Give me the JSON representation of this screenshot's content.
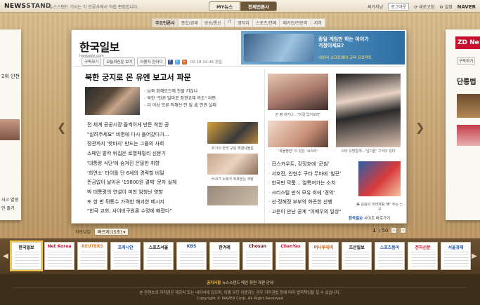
{
  "topbar": {
    "logo_a": "NEWS",
    "logo_b": "STAND",
    "tagline": "뉴스스탠드 기사는 각 언론사에서 직접 편집합니다.",
    "tabs": [
      "MY뉴스",
      "전체언론사"
    ],
    "right": [
      "써가지닝",
      "로그아웃",
      "새로고침",
      "설정",
      "NAVER"
    ]
  },
  "paper_tabs": [
    "주요언론사",
    "종합/경제",
    "방송/통신",
    "IT",
    "영자지",
    "스포츠/연예",
    "매거진/전문지",
    "지역"
  ],
  "masthead": {
    "title": "한국일보",
    "url": "hankooki.com"
  },
  "ad": {
    "line1": "종일 계임만 하는 아이가",
    "line2": "걱정이세요?",
    "line3": "네이버 소프트웨어 교육 프로젝트"
  },
  "toolbar": {
    "subscribe": "구독하기",
    "today_paper": "오늘의신문 보기",
    "help": "이용자 한마디",
    "date": "02-18 22:46 편집"
  },
  "headline": "북한 궁지로 몬 유엔 보고서 파문",
  "sub_items": [
    "남북 화해모드에 찬물 끼얹나",
    "북한 \"인권 빌미로 정권교체 의도\" 비판",
    "더 이상 모른 척해선 안 될 北 인권 실태"
  ],
  "left_list": [
    "전 세계 공공시장 들썩이게 만든 착한 공",
    "\"살려주세요\" 비명에 다시 들어갔다가…",
    "장관까지 '핫바지' 만드는 그들의 사회",
    "스페인 발칵 뒤집은 로열패밀리 신문기",
    "'대통령 식단'에 숨겨진 은밀한 취향",
    "'희연소' 타이틀 단 6세의 경력할 비밀",
    "뜬금없이 날아온 '19800원 결제' 문자 실체",
    "박 대통령의 연설이 미친 엄청난 영향",
    "또 한 번 뒤통수 가격한 해괴한 메시지",
    "\"한국 교회, 사이비구원론 수렁에 빠졌다\""
  ],
  "mid_captions": [
    "위기의 한국 구원 해결사들은",
    "'목물짱한' 이 같은 '씨스타'",
    "H.O.T 노래가 주목받는 까닭"
  ],
  "right_captions": [
    "한 평 비키니…\"이걸 입어보라\"",
    "스타 유방절개…'남다른' 구석이 있다"
  ],
  "right_list": [
    "日스카우트, 강정호에 '군침'",
    "서호진, 안현수 구타 무마에 '발끈'",
    "한국판 막툼… 얼룩져가는 소치",
    "크리스털 만식 모유 회에 '경악'",
    "선·정해정 부부의 화끈한 선행",
    "고은이 만난 공계 \"이배우의 일상\""
  ],
  "photo_caption": "美 김윤의 미래처럼 '빠' 주는 느꾸",
  "card_foot": {
    "brand": "한국일보",
    "link": "사이트 바로가기"
  },
  "subbar": {
    "label": "자동넘김",
    "select": "빠르게(15초)"
  },
  "pager": {
    "current": "1",
    "total": "/ 50"
  },
  "thumbnails": [
    "한국일보",
    "Net Korea",
    "REUTERS",
    "프레시안",
    "스포츠서울",
    "KBS",
    "한겨레",
    "Chosun",
    "ChanYas",
    "머니투데이",
    "조선일보",
    "스포츠동아",
    "전자신문",
    "서울경제"
  ],
  "footer": {
    "notice_label": "공지사항",
    "notice": "뉴스스탠드 메인 화면 개편 안내",
    "copyright_note": "본 콘텐츠의 저작권은 제공처 또는 네이버에 있으며, 이를 무단 이용하는 경우 저작권법 등에 따라 법적책임을 질 수 있습니다.",
    "copyright": "Copyright © NAVER Corp. All Right Reserved"
  },
  "side": {
    "left_lines": [
      "2위 인천",
      "사고 발생",
      "인 출거"
    ],
    "right_title": "단통법",
    "right_sub": "구독하기"
  },
  "colors": {
    "accent": "#6b5639",
    "strip": "#5a4228",
    "footer": "#3e2e1c"
  }
}
